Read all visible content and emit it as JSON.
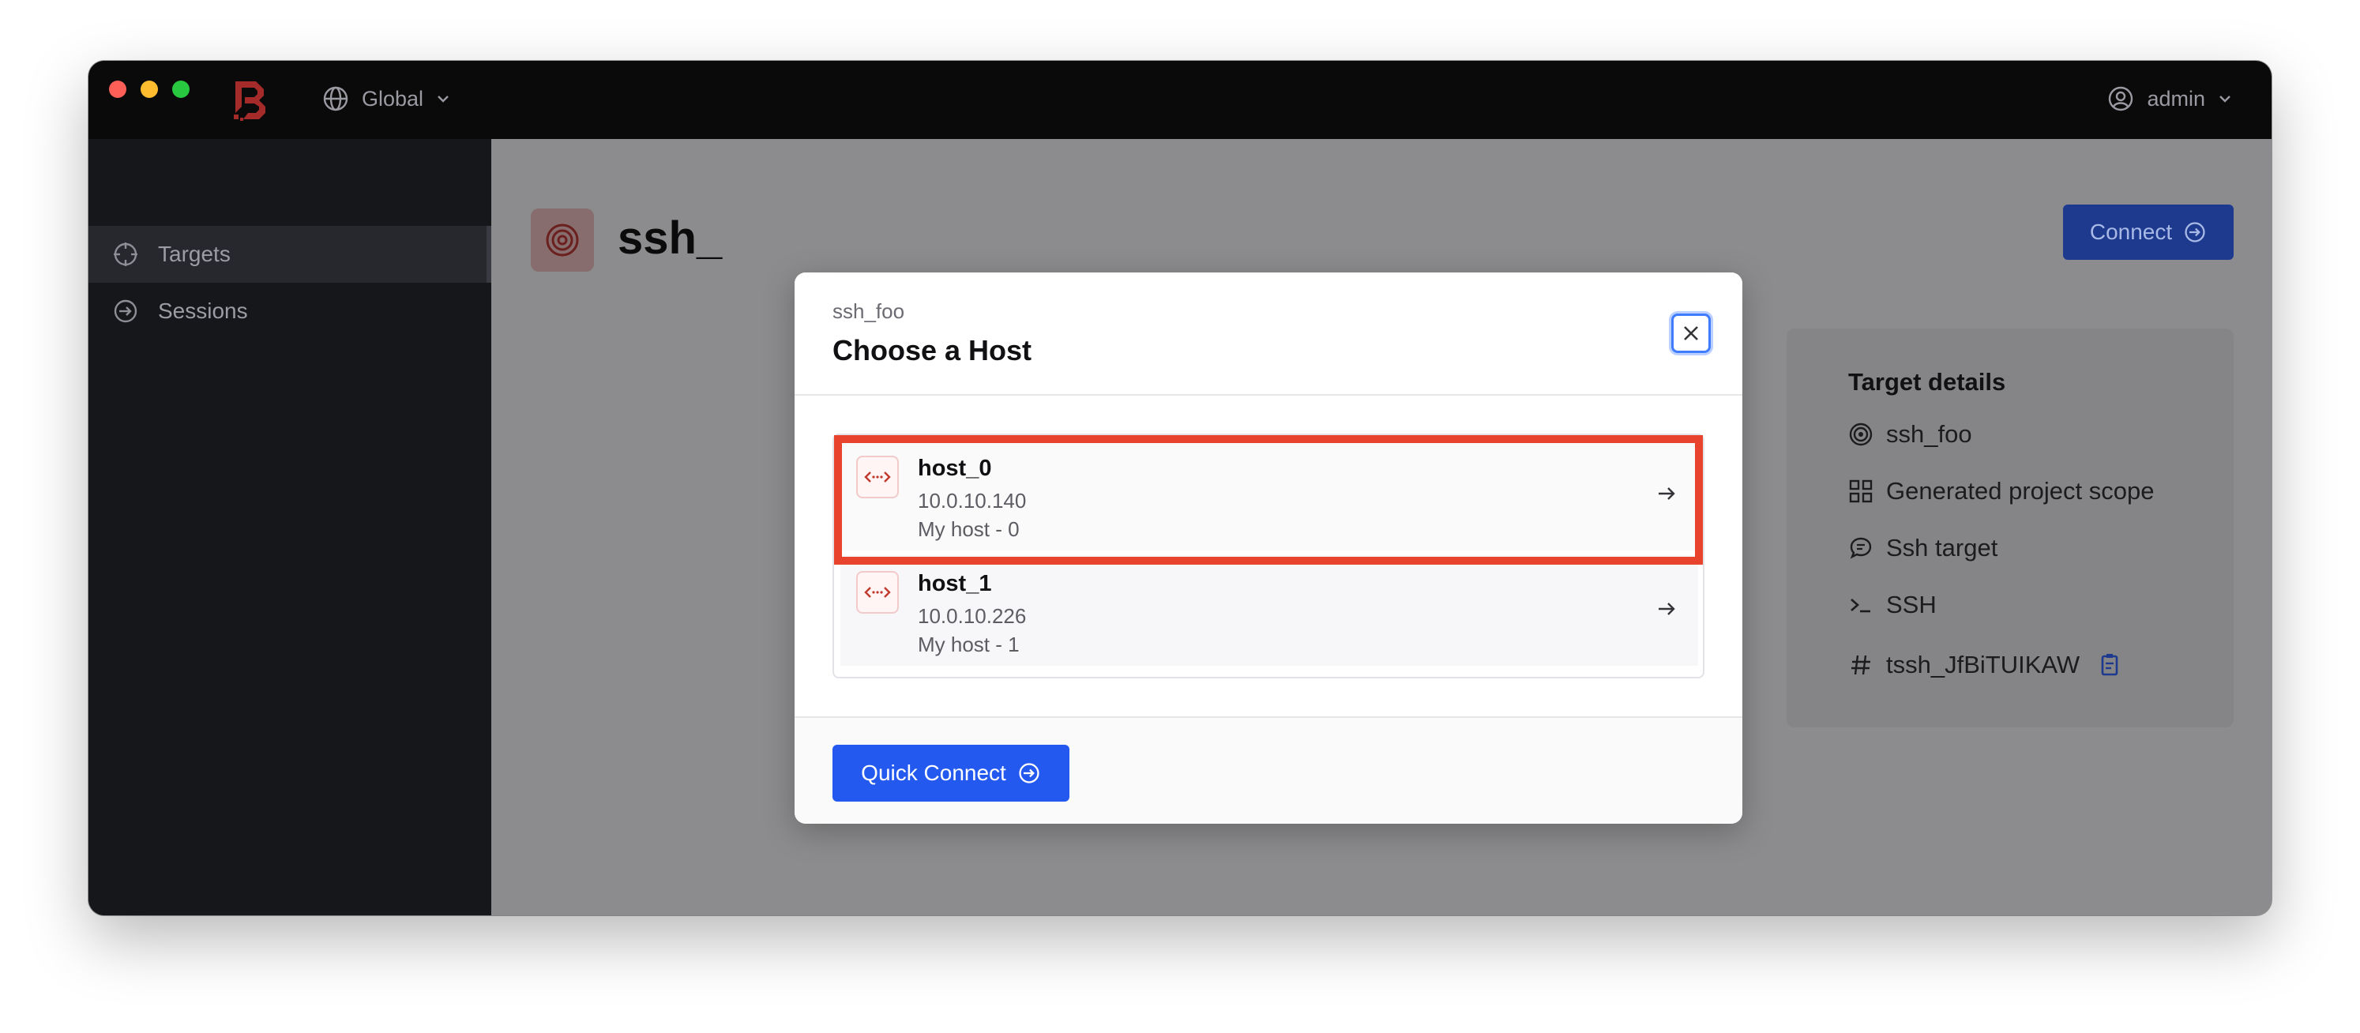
{
  "header": {
    "scope_label": "Global",
    "user_label": "admin"
  },
  "sidebar": {
    "items": [
      {
        "label": "Targets",
        "icon": "crosshair-icon"
      },
      {
        "label": "Sessions",
        "icon": "sign-in-icon"
      }
    ]
  },
  "page": {
    "title": "ssh_",
    "connect_label": "Connect"
  },
  "details": {
    "title": "Target details",
    "rows": [
      {
        "icon": "target-icon",
        "text": "ssh_foo"
      },
      {
        "icon": "grid-icon",
        "text": "Generated project scope"
      },
      {
        "icon": "chat-icon",
        "text": "Ssh target"
      },
      {
        "icon": "terminal-icon",
        "text": "SSH"
      },
      {
        "icon": "hash-icon",
        "text": "tssh_JfBiTUIKAW"
      }
    ]
  },
  "modal": {
    "subtitle": "ssh_foo",
    "title": "Choose a Host",
    "hosts": [
      {
        "name": "host_0",
        "ip": "10.0.10.140",
        "description": "My host - 0"
      },
      {
        "name": "host_1",
        "ip": "10.0.10.226",
        "description": "My host - 1"
      }
    ],
    "quick_connect_label": "Quick Connect"
  },
  "colors": {
    "accent": "#2459ef",
    "highlight": "#e8432c",
    "brand": "#c0392b"
  }
}
